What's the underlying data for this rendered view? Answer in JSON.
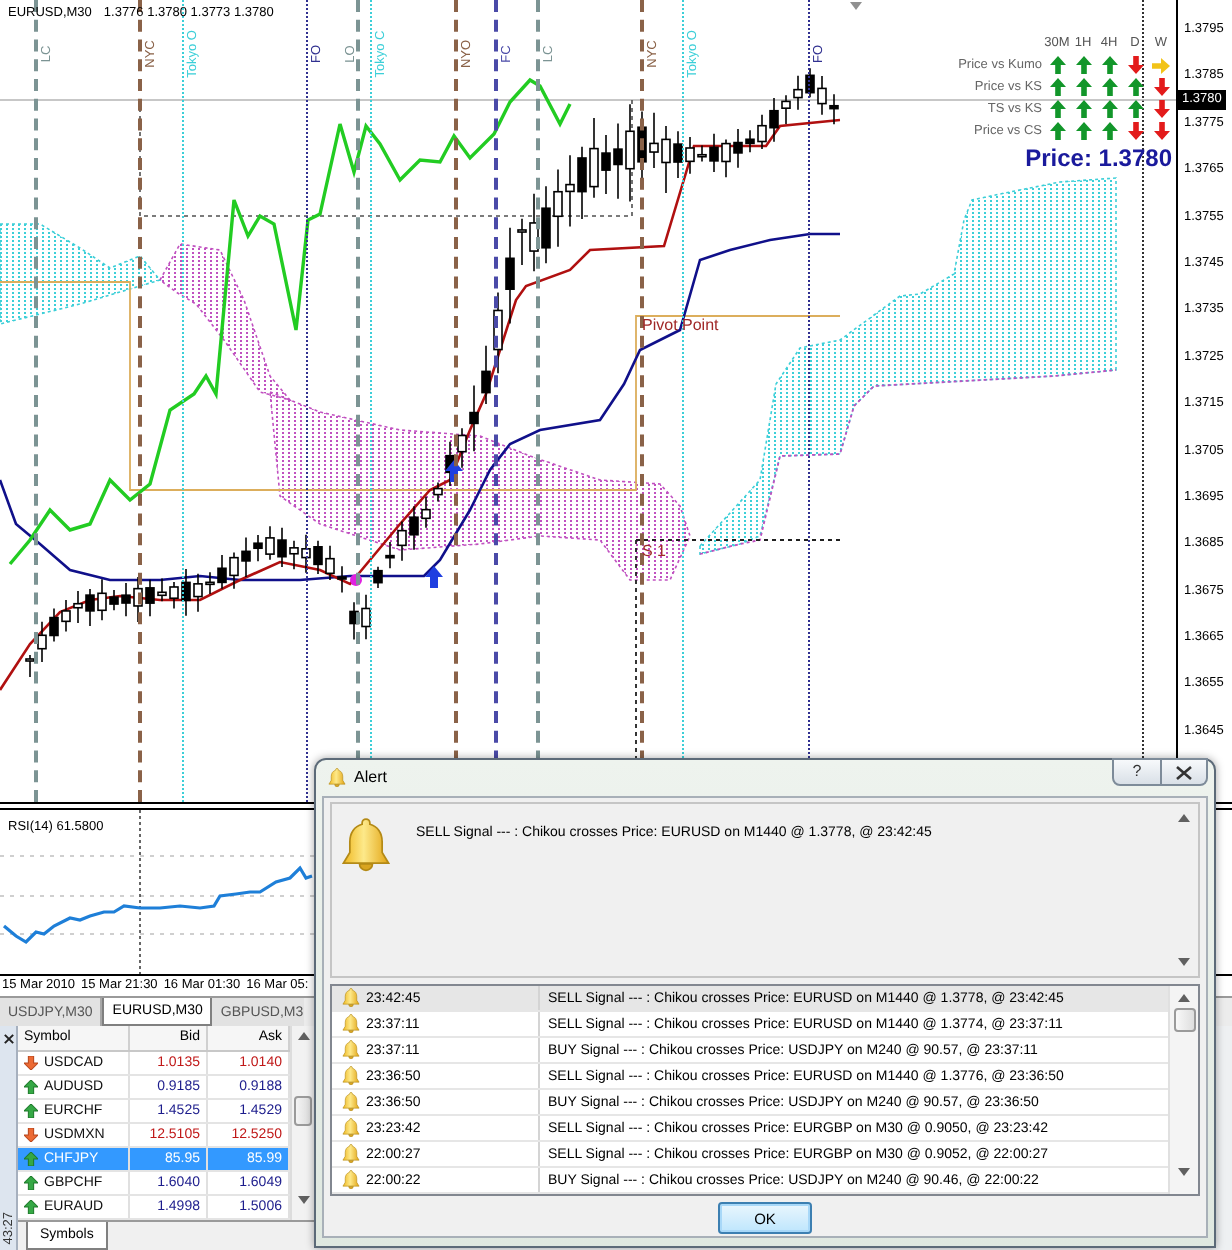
{
  "chart": {
    "title": "EURUSD,M30",
    "quote": "1.3776 1.3780 1.3773 1.3780",
    "sessions": [
      {
        "label": "LC",
        "kind": "dashed",
        "color": "#7c9494"
      },
      {
        "label": "NYC",
        "kind": "dashed",
        "color": "#8a6248"
      },
      {
        "label": "Tokyo O",
        "kind": "dotted",
        "color": "#3ccfd8"
      },
      {
        "label": "FO",
        "kind": "dotted",
        "color": "#303090"
      },
      {
        "label": "LO",
        "kind": "dashed",
        "color": "#7c9494"
      },
      {
        "label": "Tokyo C",
        "kind": "dotted",
        "color": "#3ccfd8"
      },
      {
        "label": "NYO",
        "kind": "dashed",
        "color": "#8a6248"
      },
      {
        "label": "FC",
        "kind": "dashed",
        "color": "#4a4aa8"
      },
      {
        "label": "LC",
        "kind": "dashed",
        "color": "#7c9494"
      },
      {
        "label": "NYC",
        "kind": "dashed",
        "color": "#8a6248"
      },
      {
        "label": "Tokyo O",
        "kind": "dotted",
        "color": "#3ccfd8"
      },
      {
        "label": "FO",
        "kind": "dotted",
        "color": "#303090"
      }
    ],
    "levels": [
      {
        "label": "Pivot Point"
      },
      {
        "label": "S 1"
      }
    ],
    "signal_panel": {
      "columns": [
        "30M",
        "1H",
        "4H",
        "D",
        "W"
      ],
      "rows": [
        {
          "label": "Price vs Kumo",
          "signals": [
            {
              "kind": "up"
            },
            {
              "kind": "up"
            },
            {
              "kind": "up"
            },
            {
              "kind": "down"
            },
            {
              "kind": "flat"
            }
          ]
        },
        {
          "label": "Price vs KS",
          "signals": [
            {
              "kind": "up"
            },
            {
              "kind": "up"
            },
            {
              "kind": "up"
            },
            {
              "kind": "up"
            },
            {
              "kind": "down"
            }
          ]
        },
        {
          "label": "TS vs KS",
          "signals": [
            {
              "kind": "up"
            },
            {
              "kind": "up"
            },
            {
              "kind": "up"
            },
            {
              "kind": "up"
            },
            {
              "kind": "down"
            }
          ]
        },
        {
          "label": "Price vs CS",
          "signals": [
            {
              "kind": "up"
            },
            {
              "kind": "up"
            },
            {
              "kind": "up"
            },
            {
              "kind": "down"
            },
            {
              "kind": "down"
            }
          ]
        }
      ]
    },
    "price_label": "Price: 1.3780",
    "price_axis": {
      "ticks": [
        "1.3795",
        "1.3785",
        "1.3775",
        "1.3765",
        "1.3755",
        "1.3745",
        "1.3735",
        "1.3725",
        "1.3715",
        "1.3705",
        "1.3695",
        "1.3685",
        "1.3675",
        "1.3665",
        "1.3655",
        "1.3645"
      ],
      "current": "1.3780"
    }
  },
  "rsi": {
    "label": "RSI(14) 61.5800"
  },
  "time_axis": [
    "15 Mar 2010",
    "15 Mar 21:30",
    "16 Mar 01:30",
    "16 Mar 05:"
  ],
  "chart_tabs": [
    {
      "label": "USDJPY,M30",
      "selected": false
    },
    {
      "label": "EURUSD,M30",
      "selected": true
    },
    {
      "label": "GBPUSD,M3",
      "selected": false
    }
  ],
  "market_watch": {
    "columns": [
      "Symbol",
      "Bid",
      "Ask"
    ],
    "rows": [
      {
        "symbol": "USDCAD",
        "bid": "1.0135",
        "ask": "1.0140",
        "rising": false,
        "selected": false
      },
      {
        "symbol": "AUDUSD",
        "bid": "0.9185",
        "ask": "0.9188",
        "rising": true,
        "selected": false
      },
      {
        "symbol": "EURCHF",
        "bid": "1.4525",
        "ask": "1.4529",
        "rising": true,
        "selected": false
      },
      {
        "symbol": "USDMXN",
        "bid": "12.5105",
        "ask": "12.5250",
        "rising": false,
        "selected": false
      },
      {
        "symbol": "CHFJPY",
        "bid": "85.95",
        "ask": "85.99",
        "rising": true,
        "selected": true
      },
      {
        "symbol": "GBPCHF",
        "bid": "1.6040",
        "ask": "1.6049",
        "rising": true,
        "selected": false
      },
      {
        "symbol": "EURAUD",
        "bid": "1.4998",
        "ask": "1.5006",
        "rising": true,
        "selected": false
      }
    ],
    "tabs": [
      {
        "label": "Symbols",
        "selected": true
      }
    ],
    "clock": "43:27"
  },
  "alert": {
    "title": "Alert",
    "help": "?",
    "message": "SELL Signal --- : Chikou crosses Price: EURUSD on M1440 @ 1.3778, @ 23:42:45",
    "log": [
      {
        "time": "23:42:45",
        "text": "SELL Signal --- : Chikou crosses Price: EURUSD on M1440 @ 1.3778, @ 23:42:45",
        "selected": true
      },
      {
        "time": "23:37:11",
        "text": "SELL Signal --- : Chikou crosses Price: EURUSD on M1440 @ 1.3774, @ 23:37:11",
        "selected": false
      },
      {
        "time": "23:37:11",
        "text": "BUY Signal --- : Chikou crosses Price: USDJPY on M240 @ 90.57, @ 23:37:11",
        "selected": false
      },
      {
        "time": "23:36:50",
        "text": "SELL Signal --- : Chikou crosses Price: EURUSD on M1440 @ 1.3776, @ 23:36:50",
        "selected": false
      },
      {
        "time": "23:36:50",
        "text": "BUY Signal --- : Chikou crosses Price: USDJPY on M240 @ 90.57, @ 23:36:50",
        "selected": false
      },
      {
        "time": "23:23:42",
        "text": "SELL Signal --- : Chikou crosses Price: EURGBP on M30 @ 0.9050, @ 23:23:42",
        "selected": false
      },
      {
        "time": "22:00:27",
        "text": "SELL Signal --- : Chikou crosses Price: EURGBP on M30 @ 0.9052, @ 22:00:27",
        "selected": false
      },
      {
        "time": "22:00:22",
        "text": "BUY Signal --- : Chikou crosses Price: USDJPY on M240 @ 90.46, @ 22:00:22",
        "selected": false
      }
    ],
    "button": "OK"
  }
}
